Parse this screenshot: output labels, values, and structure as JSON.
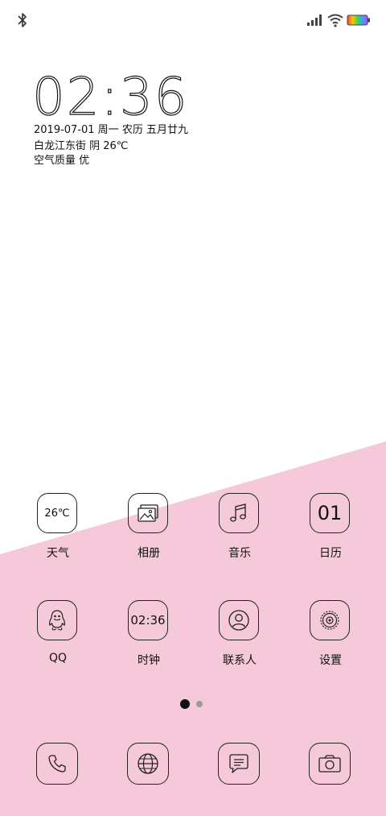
{
  "status_bar": {
    "left_icon": "bluetooth-icon",
    "right_icons": [
      "signal-icon",
      "wifi-icon",
      "battery-icon"
    ]
  },
  "lock_widget": {
    "time": "02:36",
    "date_line": "2019-07-01 周一 农历 五月廿九",
    "weather_line": "白龙江东街 阴 26℃",
    "air_quality_line": "空气质量 优"
  },
  "apps_row1": [
    {
      "label": "天气",
      "tile_text": "26℃",
      "icon": "weather-icon"
    },
    {
      "label": "相册",
      "icon": "gallery-icon"
    },
    {
      "label": "音乐",
      "icon": "music-note-icon"
    },
    {
      "label": "日历",
      "tile_text": "01",
      "icon": "calendar-icon"
    }
  ],
  "apps_row2": [
    {
      "label": "QQ",
      "icon": "qq-penguin-icon"
    },
    {
      "label": "时钟",
      "tile_text": "02:36",
      "icon": "clock-icon"
    },
    {
      "label": "联系人",
      "icon": "contacts-icon"
    },
    {
      "label": "设置",
      "icon": "settings-gear-icon"
    }
  ],
  "pagination": {
    "pages": 2,
    "current": 1
  },
  "dock": [
    {
      "icon": "phone-icon"
    },
    {
      "icon": "browser-globe-icon"
    },
    {
      "icon": "messages-icon"
    },
    {
      "icon": "camera-icon"
    }
  ],
  "colors": {
    "background_top": "#ffffff",
    "background_pink": "#f6c9da",
    "line": "#222222",
    "text": "#111111"
  }
}
